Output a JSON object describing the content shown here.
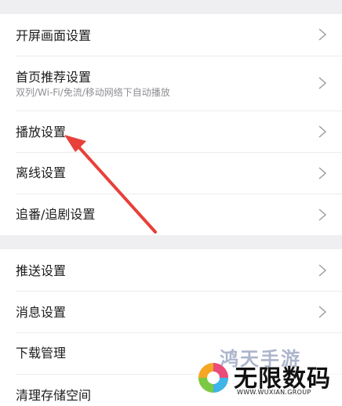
{
  "group1": {
    "items": [
      {
        "label": "开屏画面设置"
      },
      {
        "label": "首页推荐设置",
        "sub": "双列/Wi-Fi/免流/移动网络下自动播放"
      },
      {
        "label": "播放设置"
      },
      {
        "label": "离线设置"
      },
      {
        "label": "追番/追剧设置"
      }
    ]
  },
  "group2": {
    "items": [
      {
        "label": "推送设置"
      },
      {
        "label": "消息设置"
      },
      {
        "label": "下载管理"
      },
      {
        "label": "清理存储空间"
      }
    ]
  },
  "annotation": {
    "arrow_color": "#e8403a"
  },
  "watermark": {
    "top_text": "鸿天手游",
    "main_text": "无限数码",
    "url": "WWW.WUXIAN.GROUP"
  }
}
